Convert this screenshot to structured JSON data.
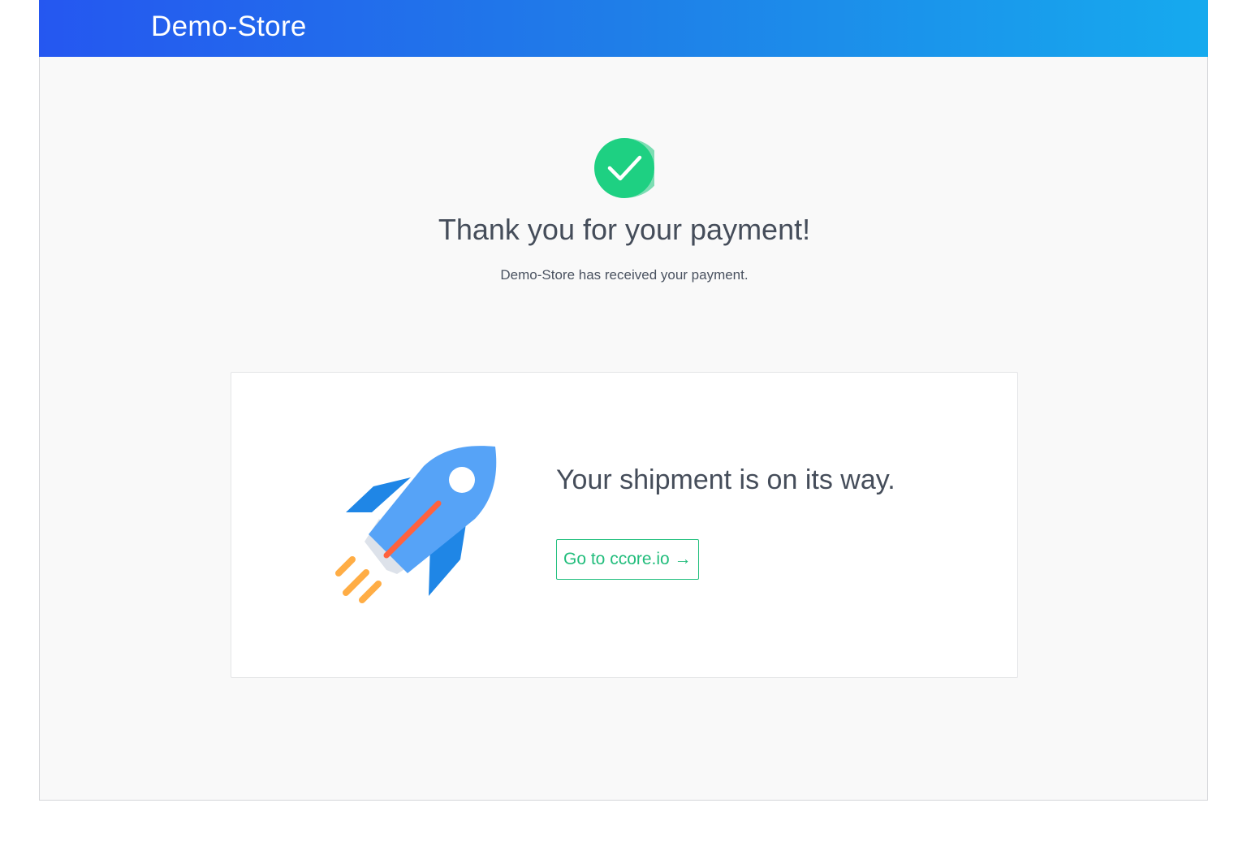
{
  "header": {
    "store_name": "Demo-Store"
  },
  "confirmation": {
    "icon": "check-circle-icon",
    "title": "Thank you for your payment!",
    "subtitle": "Demo-Store has received your payment."
  },
  "shipment": {
    "illustration": "rocket-icon",
    "message": "Your shipment is on its way.",
    "button_label": "Go to ccore.io →"
  },
  "colors": {
    "header_gradient_start": "#2557f0",
    "header_gradient_end": "#16aaee",
    "success_green": "#1ed082",
    "button_green": "#22bd7c",
    "text_dark": "#454d5a",
    "background": "#f9f9f9"
  }
}
